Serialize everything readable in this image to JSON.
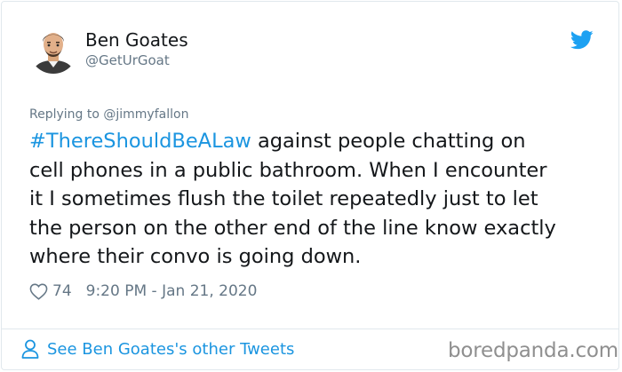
{
  "author": {
    "name": "Ben Goates",
    "handle": "@GetUrGoat"
  },
  "tweet": {
    "replying_to": "Replying to @jimmyfallon",
    "hashtag": "#ThereShouldBeALaw",
    "line1_rest": " against people chatting on",
    "line2": "cell phones in a public bathroom. When I encounter",
    "line3": "it I sometimes flush the toilet repeatedly just to let",
    "line4": "the person on the other end of the line know exactly",
    "line5": "where their convo is going down.",
    "likes": "74",
    "timestamp": "9:20 PM - Jan 21, 2020"
  },
  "footer": {
    "link_label": "See Ben Goates's other Tweets"
  },
  "watermark": "boredpanda.com",
  "icons": {
    "heart": "heart-icon",
    "bird": "twitter-bird-icon",
    "person": "person-icon",
    "avatar": "avatar"
  },
  "colors": {
    "link": "#1b95e0",
    "secondary_text": "#657786",
    "primary_text": "#14171a",
    "twitter_blue": "#1da1f2"
  }
}
